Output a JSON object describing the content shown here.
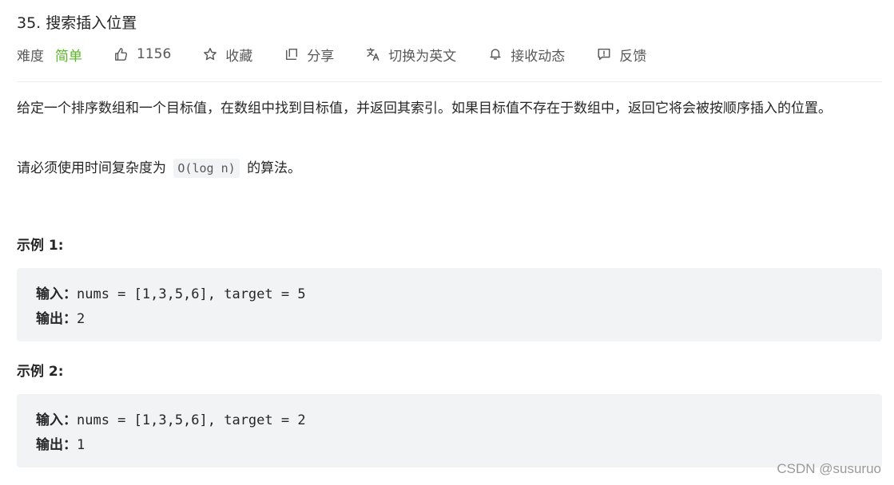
{
  "problem": {
    "title": "35. 搜索插入位置",
    "difficulty_label": "难度",
    "difficulty": "简单",
    "likes": "1156",
    "favorite_label": "收藏",
    "share_label": "分享",
    "switch_lang_label": "切换为英文",
    "subscribe_label": "接收动态",
    "feedback_label": "反馈"
  },
  "description": {
    "text": "给定一个排序数组和一个目标值，在数组中找到目标值，并返回其索引。如果目标值不存在于数组中，返回它将会被按顺序插入的位置。",
    "req_prefix": "请必须使用时间复杂度为",
    "req_code": "O(log n)",
    "req_suffix": "的算法。"
  },
  "examples": [
    {
      "title": "示例 1:",
      "input_label": "输入：",
      "input": "nums = [1,3,5,6], target = 5",
      "output_label": "输出：",
      "output": "2"
    },
    {
      "title": "示例 2:",
      "input_label": "输入：",
      "input": "nums = [1,3,5,6], target = 2",
      "output_label": "输出：",
      "output": "1"
    }
  ],
  "watermark": "CSDN @susuruo",
  "colors": {
    "difficulty_easy": "#5ab726",
    "code_bg": "#f2f3f5"
  },
  "icons": [
    "thumbs-up-icon",
    "star-icon",
    "share-icon",
    "translate-icon",
    "bell-icon",
    "feedback-icon"
  ]
}
